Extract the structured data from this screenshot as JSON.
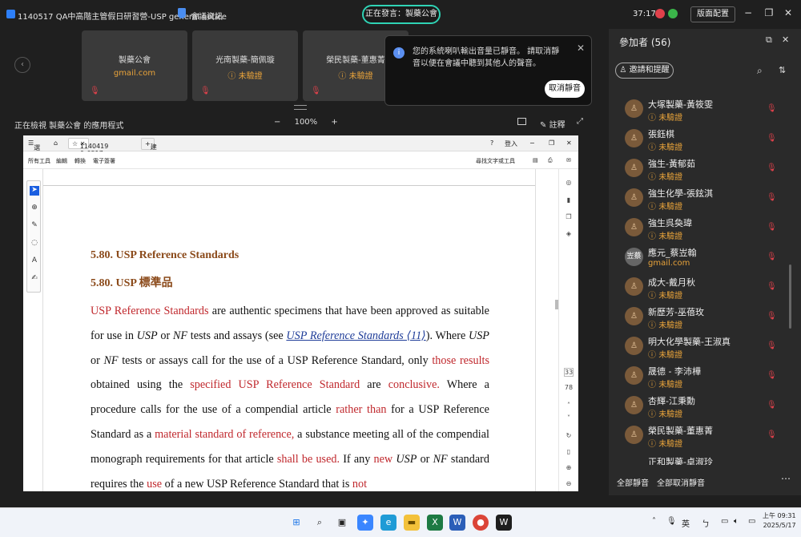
{
  "titlebar": {
    "meeting_title": "1140517 QA中高階主管假日研習營-USP general notice",
    "meeting_info": "會議資訊",
    "speaking": "正在發言：製藥公會",
    "timer": "37:17",
    "layout": "版面配置"
  },
  "tiles": [
    {
      "name": "製藥公會",
      "sub": "gmail.com",
      "sub_color": "#e8a33a"
    },
    {
      "name": "光南製藥-簡佩璇",
      "sub": "未驗證"
    },
    {
      "name": "榮民製藥-董惠菁",
      "sub": "未驗證"
    }
  ],
  "notice": {
    "message": "您的系統喇叭輸出音量已靜音。 請取消靜音以便在會議中聽到其他人的聲音。",
    "button": "取消靜音"
  },
  "viewbar": {
    "viewing": "正在檢視 製藥公會 的應用程式",
    "zoom_minus": "−",
    "zoom": "100%",
    "zoom_plus": "+",
    "annotate": "註釋"
  },
  "browser": {
    "menu": "選單",
    "tab": "1140419 & 0517 課程...",
    "newtab": "建立",
    "signin": "登入",
    "find": "尋找文字或工具",
    "tools": [
      "所有工具",
      "編輯",
      "轉換",
      "電子簽署"
    ]
  },
  "doc": {
    "h1": "5.80. USP Reference Standards",
    "h2": "5.80. USP  標準品",
    "p": [
      {
        "t": "USP Reference Standards",
        "c": "red"
      },
      {
        "t": " are authentic specimens that have been approved as suitable for use in "
      },
      {
        "t": "USP",
        "c": "it"
      },
      {
        "t": " or "
      },
      {
        "t": "NF",
        "c": "it"
      },
      {
        "t": " tests and assays (see "
      },
      {
        "t": "USP Reference Standards ⟨11⟩",
        "c": "link"
      },
      {
        "t": "). Where "
      },
      {
        "t": "USP",
        "c": "it"
      },
      {
        "t": " or "
      },
      {
        "t": "NF",
        "c": "it"
      },
      {
        "t": " tests or assays call for the use of a USP Reference Standard, only "
      },
      {
        "t": "those results",
        "c": "red"
      },
      {
        "t": " obtained using the "
      },
      {
        "t": "specified USP Reference Standard",
        "c": "red"
      },
      {
        "t": " are "
      },
      {
        "t": "conclusive.",
        "c": "red"
      },
      {
        "t": " Where a procedure calls for the use of a compendial article "
      },
      {
        "t": "rather than",
        "c": "red"
      },
      {
        "t": " for a USP Reference Standard as a "
      },
      {
        "t": "material standard of reference,",
        "c": "red"
      },
      {
        "t": " a substance meeting all of the compendial monograph requirements for that article "
      },
      {
        "t": "shall be used.",
        "c": "red"
      },
      {
        "t": " If any "
      },
      {
        "t": "new",
        "c": "red"
      },
      {
        "t": " "
      },
      {
        "t": "USP",
        "c": "it"
      },
      {
        "t": " or "
      },
      {
        "t": "NF",
        "c": "it"
      },
      {
        "t": " standard requires the "
      },
      {
        "t": "use",
        "c": "red"
      },
      {
        "t": " of a new USP Reference Standard that is "
      },
      {
        "t": "not",
        "c": "red"
      }
    ]
  },
  "rightbar": {
    "page": "33",
    "total": "78"
  },
  "panel": {
    "title": "參加者 (56)",
    "invite": "邀請和提醒",
    "participants": [
      {
        "name": "大塚製藥-黃筱雯",
        "sub": "未驗證"
      },
      {
        "name": "張鈺棋",
        "sub": "未驗證"
      },
      {
        "name": "強生-黃郁茹",
        "sub": "未驗證"
      },
      {
        "name": "強生化學-張鉉淇",
        "sub": "未驗證"
      },
      {
        "name": "強生呉奐瑋",
        "sub": "未驗證"
      },
      {
        "name": "應元_蔡岦翰",
        "sub": "gmail.com",
        "avatar": "岦蔡"
      },
      {
        "name": "成大-戴月秋",
        "sub": "未驗證"
      },
      {
        "name": "新歷芳-巫蓓玫",
        "sub": "未驗證"
      },
      {
        "name": "明大化學製藥-王淑真",
        "sub": "未驗證"
      },
      {
        "name": "晟德 - 李沛樺",
        "sub": "未驗證"
      },
      {
        "name": "杏輝-江秉勳",
        "sub": "未驗證"
      },
      {
        "name": "榮民製藥-董惠菁",
        "sub": "未驗證"
      }
    ],
    "partial": "正和製藥-卓淑玲",
    "mute_all": "全部靜音",
    "unmute_all": "全部取消靜音"
  },
  "taskbar": {
    "ime": "英",
    "time": "上午 09:31",
    "date": "2025/5/17"
  }
}
